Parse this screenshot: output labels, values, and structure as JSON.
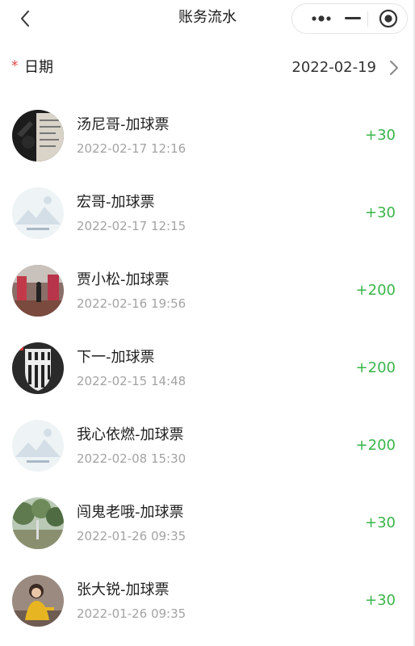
{
  "nav": {
    "title": "账务流水",
    "back_icon": "chevron-left-icon",
    "capsule": {
      "more_icon": "more-dots-icon",
      "minimize_icon": "minimize-icon",
      "close_icon": "target-circle-icon"
    }
  },
  "filter": {
    "required_mark": "*",
    "label": "日期",
    "value": "2022-02-19",
    "arrow_icon": "chevron-right-icon"
  },
  "records": [
    {
      "title": "汤尼哥-加球票",
      "time": "2022-02-17 12:16",
      "amount": "+30",
      "avatar": "photo-avatar"
    },
    {
      "title": "宏哥-加球票",
      "time": "2022-02-17 12:15",
      "amount": "+30",
      "avatar": "default-avatar"
    },
    {
      "title": "贾小松-加球票",
      "time": "2022-02-16 19:56",
      "amount": "+200",
      "avatar": "photo-avatar"
    },
    {
      "title": "下一-加球票",
      "time": "2022-02-15 14:48",
      "amount": "+200",
      "avatar": "photo-avatar"
    },
    {
      "title": "我心依燃-加球票",
      "time": "2022-02-08 15:30",
      "amount": "+200",
      "avatar": "default-avatar"
    },
    {
      "title": "闯鬼老哦-加球票",
      "time": "2022-01-26 09:35",
      "amount": "+30",
      "avatar": "photo-avatar"
    },
    {
      "title": "张大锐-加球票",
      "time": "2022-01-26 09:35",
      "amount": "+30",
      "avatar": "photo-avatar"
    }
  ],
  "colors": {
    "amount": "#39b54a",
    "required": "#e64340",
    "time": "#a3a3a3"
  }
}
